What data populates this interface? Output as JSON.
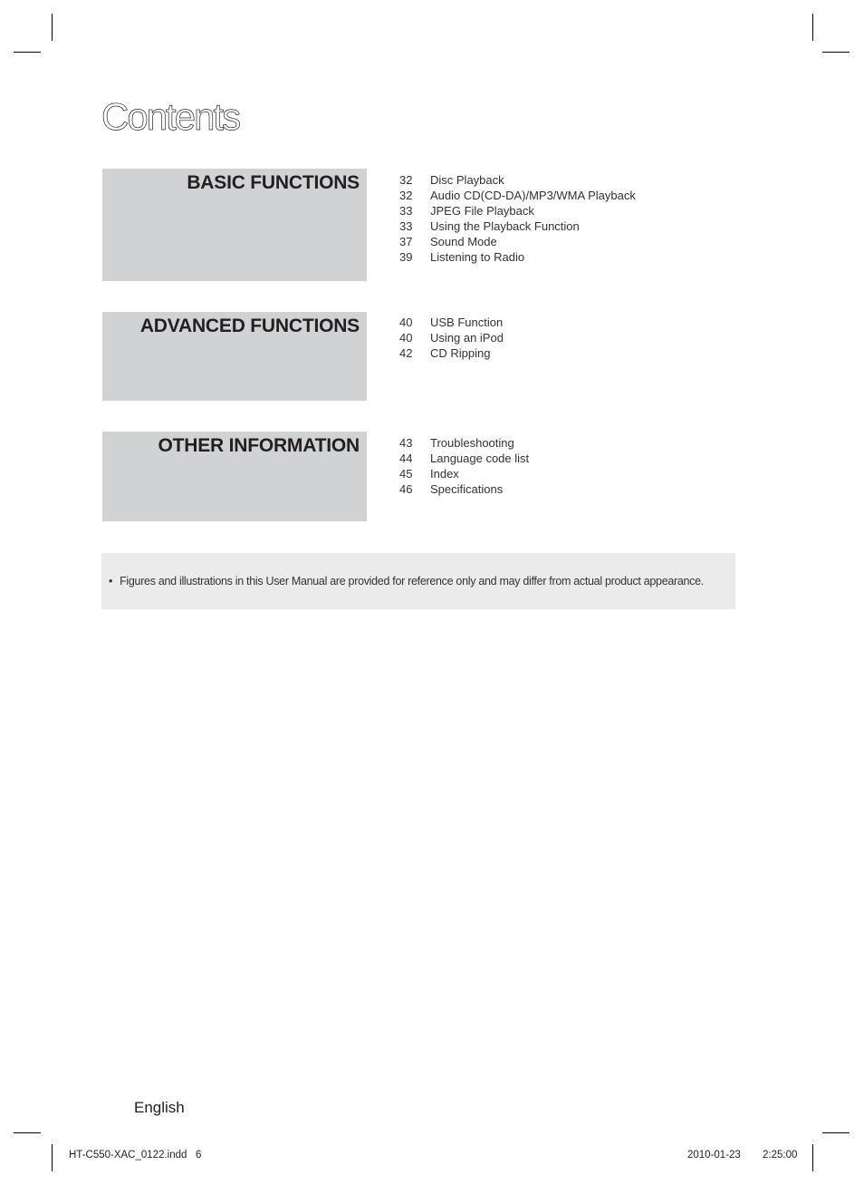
{
  "page": {
    "title": "Contents",
    "sections": [
      {
        "heading": "BASIC FUNCTIONS",
        "entries": [
          {
            "page": "32",
            "label": "Disc Playback"
          },
          {
            "page": "32",
            "label": "Audio CD(CD-DA)/MP3/WMA Playback"
          },
          {
            "page": "33",
            "label": "JPEG File Playback"
          },
          {
            "page": "33",
            "label": "Using the Playback Function"
          },
          {
            "page": "37",
            "label": "Sound Mode"
          },
          {
            "page": "39",
            "label": "Listening to Radio"
          }
        ]
      },
      {
        "heading": "ADVANCED FUNCTIONS",
        "entries": [
          {
            "page": "40",
            "label": "USB Function"
          },
          {
            "page": "40",
            "label": "Using an iPod"
          },
          {
            "page": "42",
            "label": "CD Ripping"
          }
        ]
      },
      {
        "heading": "OTHER INFORMATION",
        "entries": [
          {
            "page": "43",
            "label": "Troubleshooting"
          },
          {
            "page": "44",
            "label": "Language code list"
          },
          {
            "page": "45",
            "label": "Index"
          },
          {
            "page": "46",
            "label": "Specifications"
          }
        ]
      }
    ],
    "note": {
      "bullet": "•",
      "text": "Figures and illustrations in this User Manual are provided for reference only and may differ from actual product appearance."
    },
    "footer": {
      "language": "English",
      "slug_file": "HT-C550-XAC_0122.indd   6",
      "slug_date": "2010-01-23",
      "slug_time": "2:25:00"
    }
  }
}
